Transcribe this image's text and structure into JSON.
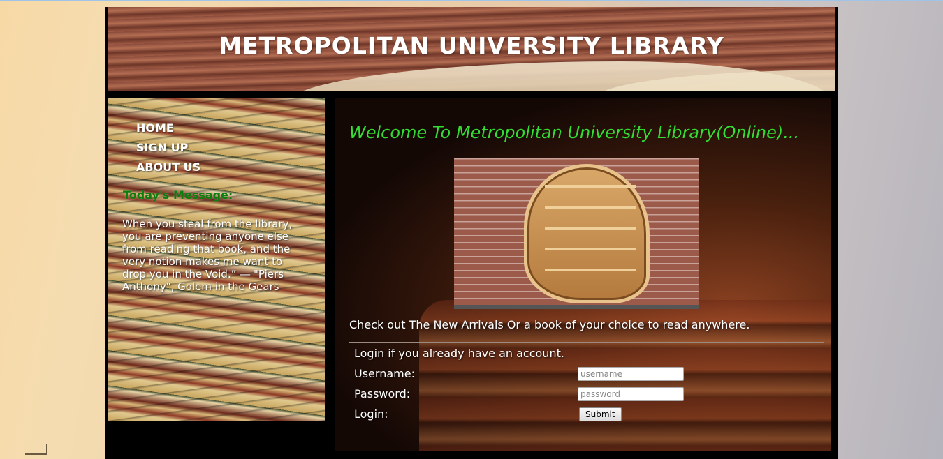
{
  "header": {
    "title": "METROPOLITAN UNIVERSITY LIBRARY"
  },
  "sidebar": {
    "nav": [
      {
        "label": "HOME"
      },
      {
        "label": "SIGN UP"
      },
      {
        "label": "ABOUT US"
      }
    ],
    "message_title": "Today's Message:",
    "message_body": "When you steal from the library, you are preventing anyone else from reading that book, and the very notion makes me want to drop you in the Void.” ― \"Piers Anthony\", Golem in the Gears"
  },
  "main": {
    "welcome": "Welcome To Metropolitan University Library(Online)...",
    "intro": "Check out The New Arrivals Or a book of your choice to read anywhere.",
    "login": {
      "prompt": "Login if you already have an account.",
      "username_label": "Username:",
      "username_placeholder": "username",
      "password_label": "Password:",
      "password_placeholder": "password",
      "login_label": "Login:",
      "submit_label": "Submit"
    }
  },
  "colors": {
    "welcome_text": "#33dd33",
    "message_title": "#0b7f0b"
  }
}
